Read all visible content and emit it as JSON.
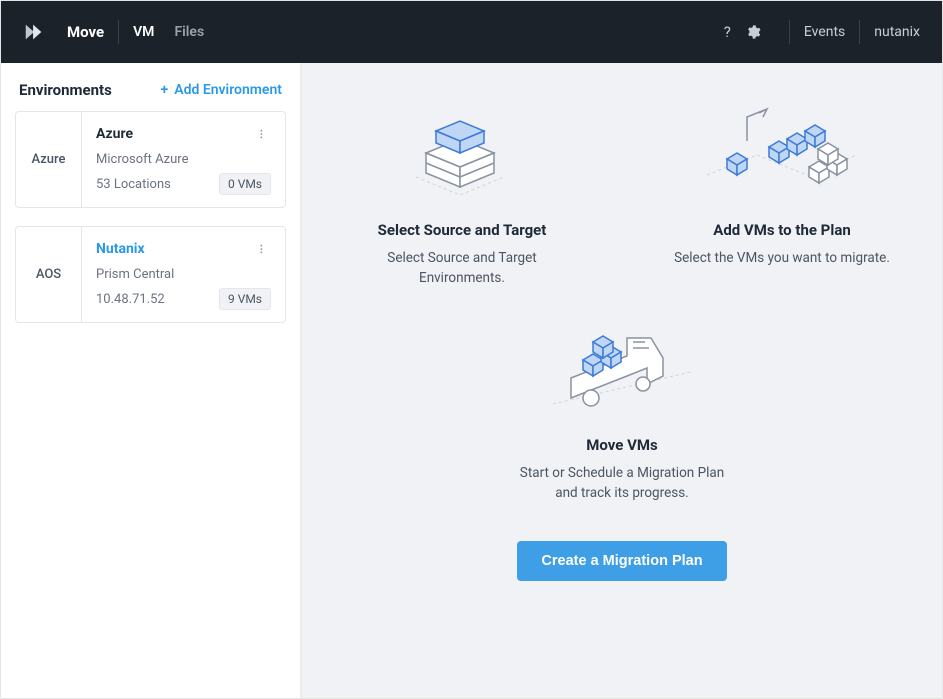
{
  "header": {
    "brand": "Move",
    "nav_vm": "VM",
    "nav_files": "Files",
    "events_label": "Events",
    "user_label": "nutanix"
  },
  "sidebar": {
    "title": "Environments",
    "add_label": "Add Environment",
    "environments": [
      {
        "type": "Azure",
        "name": "Azure",
        "provider": "Microsoft Azure",
        "meta": "53 Locations",
        "vms": "0 VMs",
        "name_link": false
      },
      {
        "type": "AOS",
        "name": "Nutanix",
        "provider": "Prism Central",
        "meta": "10.48.71.52",
        "vms": "9 VMs",
        "name_link": true
      }
    ]
  },
  "content": {
    "steps": [
      {
        "title": "Select Source and Target",
        "desc": "Select Source and Target Environments."
      },
      {
        "title": "Add VMs to the Plan",
        "desc": "Select the VMs you want to migrate."
      },
      {
        "title": "Move VMs",
        "desc": "Start or Schedule a Migration Plan and track its progress."
      }
    ],
    "cta_label": "Create a Migration Plan"
  }
}
